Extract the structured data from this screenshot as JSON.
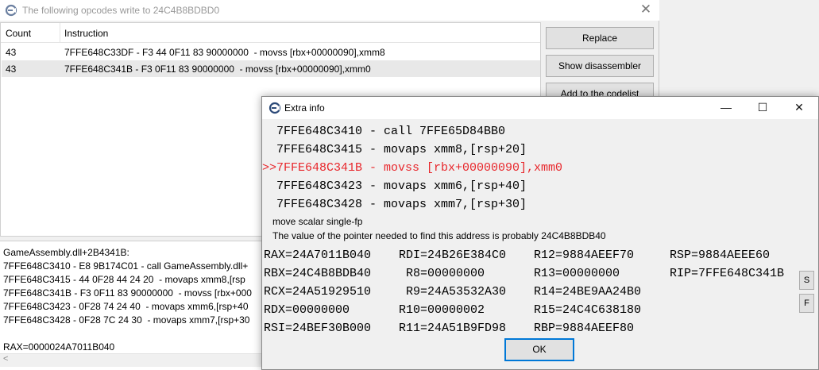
{
  "back_window": {
    "title": "The following opcodes write to 24C4B8BDBD0",
    "close_glyph": "✕",
    "list": {
      "headers": {
        "count": "Count",
        "instruction": "Instruction"
      },
      "rows": [
        {
          "count": "43",
          "instruction": "7FFE648C33DF - F3 44 0F11 83 90000000  - movss [rbx+00000090],xmm8"
        },
        {
          "count": "43",
          "instruction": "7FFE648C341B - F3 0F11 83 90000000  - movss [rbx+00000090],xmm0"
        }
      ]
    },
    "buttons": {
      "replace": "Replace",
      "show_disassembler": "Show disassembler",
      "add_to_codelist": "Add to the codelist"
    },
    "disasm_lines": [
      "GameAssembly.dll+2B4341B:",
      "7FFE648C3410 - E8 9B174C01 - call GameAssembly.dll+",
      "7FFE648C3415 - 44 0F28 44 24 20  - movaps xmm8,[rsp",
      "7FFE648C341B - F3 0F11 83 90000000  - movss [rbx+000",
      "7FFE648C3423 - 0F28 74 24 40  - movaps xmm6,[rsp+40",
      "7FFE648C3428 - 0F28 7C 24 30  - movaps xmm7,[rsp+30",
      "",
      "RAX=0000024A7011B040"
    ]
  },
  "extra_info": {
    "title": "Extra info",
    "controls": {
      "minimize": "—",
      "maximize": "☐",
      "close": "✕"
    },
    "instructions": [
      "  7FFE648C3410 - call 7FFE65D84BB0",
      "  7FFE648C3415 - movaps xmm8,[rsp+20]",
      ">>7FFE648C341B - movss [rbx+00000090],xmm0",
      "  7FFE648C3423 - movaps xmm6,[rsp+40]",
      "  7FFE648C3428 - movaps xmm7,[rsp+30]"
    ],
    "description": "move scalar single-fp",
    "pointer_note": "The value of the pointer needed to find this address is probably 24C4B8BDB40",
    "registers": [
      [
        "RAX=24A7011B040",
        "RDI=24B26E384C0",
        "R12=9884AEEF70",
        "RSP=9884AEEE60"
      ],
      [
        "RBX=24C4B8BDB40",
        " R8=00000000",
        "R13=00000000",
        "RIP=7FFE648C341B"
      ],
      [
        "RCX=24A51929510",
        " R9=24A53532A30",
        "R14=24BE9AA24B0",
        ""
      ],
      [
        "RDX=00000000",
        "R10=00000002",
        "R15=24C4C638180",
        ""
      ],
      [
        "RSI=24BEF30B000",
        "R11=24A51B9FD98",
        "RBP=9884AEEF80",
        ""
      ]
    ],
    "side_buttons": {
      "s": "S",
      "f": "F"
    },
    "ok": "OK"
  }
}
